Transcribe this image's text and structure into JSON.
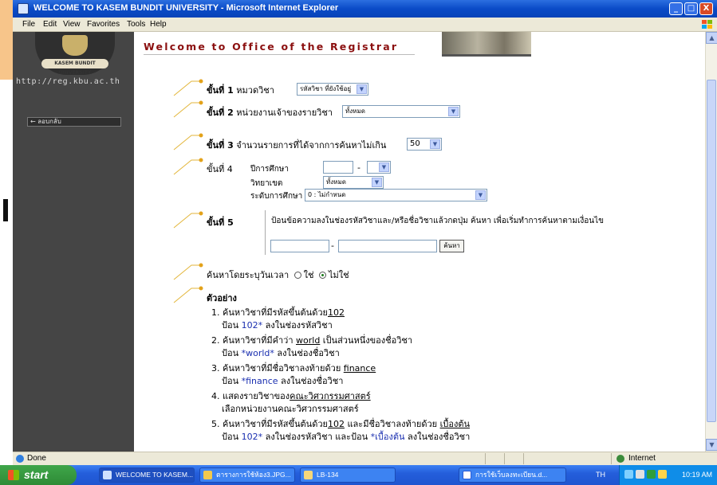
{
  "window": {
    "title": "WELCOME TO KASEM BUNDIT UNIVERSITY - Microsoft Internet Explorer",
    "controls": {
      "minimize": "_",
      "maximize": "□",
      "close": "X"
    }
  },
  "menu": [
    "File",
    "Edit",
    "View",
    "Favorites",
    "Tools",
    "Help"
  ],
  "site": {
    "logo_text": "KASEM BUNDIT UNIVERSITY",
    "url": "http://reg.kbu.ac.th",
    "back_button": "← ลอบกลับ",
    "welcome": "Welcome to Office of the Registrar"
  },
  "steps": {
    "s1": {
      "label": "ขั้นที่ 1",
      "text": "หมวดวิชา",
      "select": "รหัสวิชา ที่ยังใช้อยู่"
    },
    "s2": {
      "label": "ขั้นที่ 2",
      "text": "หน่วยงานเจ้าของรายวิชา",
      "select": "ทั้งหมด"
    },
    "s3": {
      "label": "ขั้นที่ 3",
      "text": "จำนวนรายการที่ได้จากการค้นหาไม่เกิน",
      "select": "50"
    },
    "s4": {
      "label": "ขั้นที่ 4",
      "year_label": "ปีการศึกษา",
      "year_dash": "-",
      "campus_label": "วิทยาเขต",
      "campus_select": "ทั้งหมด",
      "level_label": "ระดับการศึกษา",
      "level_select": "0 : ไม่กำหนด"
    },
    "s5": {
      "label": "ขั้นที่ 5",
      "text": "ป้อนข้อความลงในช่องรหัสวิชาและ/หรือชื่อวิชาแล้วกดปุ่ม ค้นหา เพื่อเริ่มทำการค้นหาตามเงื่อนไข",
      "dash": "-",
      "search_button": "ค้นหา"
    },
    "time_search": {
      "text": "ค้นหาโดยระบุวันเวลา",
      "yes": "ใช่",
      "no": "ไม่ใช่",
      "selected": "ไม่ใช่"
    }
  },
  "examples": {
    "title": "ตัวอย่าง",
    "items": [
      {
        "line1_a": "1. ค้นหาวิชาที่มีรหัสขึ้นต้นด้วย",
        "line1_u": "102",
        "line1_b": "",
        "line2_a": "ป้อน ",
        "line2_hl": "102*",
        "line2_b": " ลงในช่องรหัสวิชา"
      },
      {
        "line1_a": "2. ค้นหาวิชาที่มีคำว่า ",
        "line1_u": "world",
        "line1_b": " เป็นส่วนหนึ่งของชื่อวิชา",
        "line2_a": "ป้อน ",
        "line2_hl": "*world*",
        "line2_b": " ลงในช่องชื่อวิชา"
      },
      {
        "line1_a": "3. ค้นหาวิชาที่มีชื่อวิชาลงท้ายด้วย ",
        "line1_u": "finance",
        "line1_b": "",
        "line2_a": "ป้อน ",
        "line2_hl": "*finance",
        "line2_b": " ลงในช่องชื่อวิชา"
      },
      {
        "line1_a": "4. แสดงรายวิชาของ",
        "line1_u": "คณะวิศวกรรมศาสตร์",
        "line1_b": "",
        "line2_a": "เลือกหน่วยงานคณะวิศวกรรมศาสตร์",
        "line2_hl": "",
        "line2_b": ""
      },
      {
        "line1_a": "5. ค้นหาวิชาที่มีรหัสขึ้นต้นด้วย",
        "line1_u": "102",
        "line1_b": " และมีชื่อวิชาลงท้ายด้วย ",
        "line1_u2": "เบื้องต้น",
        "line2_a": "ป้อน ",
        "line2_hl": "102*",
        "line2_b": " ลงในช่องรหัสวิชา และป้อน ",
        "line2_hl2": "*เบื้องต้น",
        "line2_c": " ลงในช่องชื่อวิชา"
      }
    ]
  },
  "status": {
    "text": "Done",
    "zone": "Internet"
  },
  "taskbar": {
    "start": "start",
    "tasks": [
      "WELCOME TO KASEM...",
      "ตารางการใช้ห้อง3.JPG...",
      "LB-134",
      "การใช้เว็บลงทะเบียน.d..."
    ],
    "lang": "TH",
    "clock": "10:19 AM"
  },
  "colors": {
    "accent_title": "#8b0f0f",
    "step_line": "#e3b63b",
    "link_blue": "#1a2fb0"
  }
}
